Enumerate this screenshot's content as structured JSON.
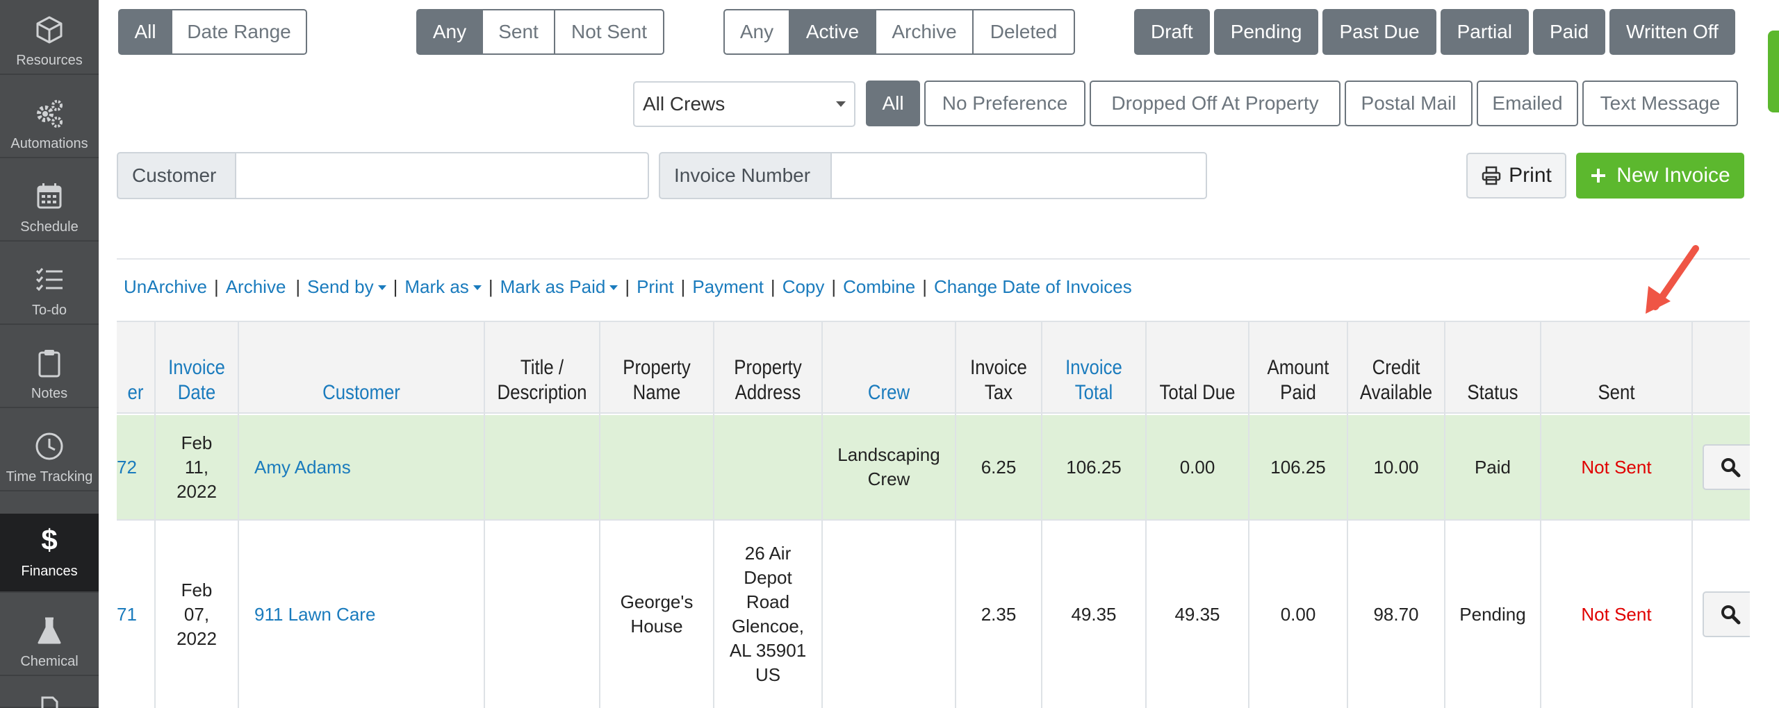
{
  "sidebar": {
    "items": [
      {
        "label": "Resources",
        "icon": "cube-icon"
      },
      {
        "label": "Automations",
        "icon": "gears-icon"
      },
      {
        "label": "Schedule",
        "icon": "calendar-icon"
      },
      {
        "label": "To-do",
        "icon": "checklist-icon"
      },
      {
        "label": "Notes",
        "icon": "clipboard-icon"
      },
      {
        "label": "Time Tracking",
        "icon": "clock-icon"
      },
      {
        "label": "Finances",
        "icon": "dollar-icon",
        "active": true
      },
      {
        "label": "Chemical",
        "icon": "flask-icon"
      }
    ]
  },
  "filters": {
    "date": [
      "All",
      "Date Range"
    ],
    "sent": [
      "Any",
      "Sent",
      "Not Sent"
    ],
    "state": [
      "Any",
      "Active",
      "Archive",
      "Deleted"
    ],
    "status": [
      "Draft",
      "Pending",
      "Past Due",
      "Partial",
      "Paid",
      "Written Off"
    ],
    "crew_select": "All Crews",
    "delivery": [
      "All",
      "No Preference",
      "Dropped Off At Property",
      "Postal Mail",
      "Emailed",
      "Text Message"
    ]
  },
  "search": {
    "customer_label": "Customer",
    "customer_value": "",
    "invoice_label": "Invoice Number",
    "invoice_value": ""
  },
  "toolbar": {
    "print_label": "Print",
    "new_invoice_label": "New Invoice"
  },
  "actions": {
    "unarchive": "UnArchive",
    "archive": "Archive",
    "send_by": "Send by",
    "mark_as": "Mark as",
    "mark_as_paid": "Mark as Paid",
    "print": "Print",
    "payment": "Payment",
    "copy": "Copy",
    "combine": "Combine",
    "change_date": "Change Date of Invoices"
  },
  "table": {
    "headers": {
      "number": "er",
      "invoice_date": "Invoice Date",
      "customer": "Customer",
      "title": "Title / Description",
      "property_name": "Property Name",
      "property_address": "Property Address",
      "crew": "Crew",
      "invoice_tax": "Invoice Tax",
      "invoice_total": "Invoice Total",
      "total_due": "Total Due",
      "amount_paid": "Amount Paid",
      "credit_available": "Credit Available",
      "status": "Status",
      "sent": "Sent"
    },
    "rows": [
      {
        "number": "72",
        "date": "Feb 11, 2022",
        "customer": "Amy Adams",
        "title": "",
        "property_name": "",
        "property_address": "",
        "crew": "Landscaping Crew",
        "tax": "6.25",
        "total": "106.25",
        "due": "0.00",
        "paid": "106.25",
        "credit": "10.00",
        "status": "Paid",
        "sent": "Not Sent"
      },
      {
        "number": "71",
        "date": "Feb 07, 2022",
        "customer": "911 Lawn Care",
        "title": "",
        "property_name": "George's House",
        "property_address": "26 Air Depot Road Glencoe, AL 35901 US",
        "crew": "",
        "tax": "2.35",
        "total": "49.35",
        "due": "49.35",
        "paid": "0.00",
        "credit": "98.70",
        "status": "Pending",
        "sent": "Not Sent"
      }
    ]
  },
  "colors": {
    "sidebar_bg": "#4b4d4f",
    "sidebar_active": "#1f2022",
    "button_gray": "#6c757d",
    "link_blue": "#1a7bbd",
    "success_green": "#5cb82e",
    "row_highlight": "#dff0d8",
    "not_sent_red": "#e00000",
    "arrow_red": "#ef5545"
  }
}
